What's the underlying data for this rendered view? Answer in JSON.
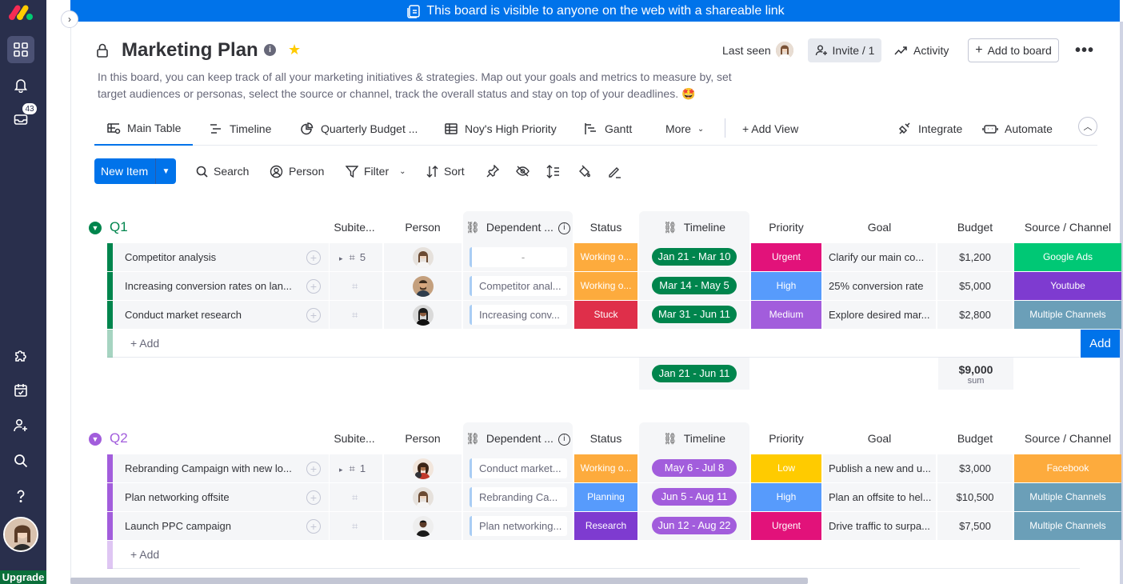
{
  "banner": {
    "text": "This board is visible to anyone on the web with a shareable link"
  },
  "rail": {
    "inbox_count": "43",
    "upgrade_label": "Upgrade"
  },
  "header": {
    "title": "Marketing Plan",
    "description": "In this board, you can keep track of all your marketing initiatives & strategies. Map out your goals and metrics to measure by, set target audiences or personas, select the source or channel, track the overall status and stay on top of your deadlines. 🤩",
    "last_seen_label": "Last seen",
    "invite_label": "Invite / 1",
    "activity_label": "Activity",
    "add_to_board_label": "Add to board",
    "more_label": "•••"
  },
  "tabs": [
    {
      "label": "Main Table",
      "icon": "table-icon"
    },
    {
      "label": "Timeline",
      "icon": "timeline-icon"
    },
    {
      "label": "Quarterly Budget ...",
      "icon": "pie-icon"
    },
    {
      "label": "Noy's High Priority",
      "icon": "grid-icon"
    },
    {
      "label": "Gantt",
      "icon": "gantt-icon"
    },
    {
      "label": "More",
      "icon": "chevron-down-icon"
    },
    {
      "label": "+ Add View",
      "icon": ""
    },
    {
      "label": "Integrate",
      "icon": "integrate-icon"
    },
    {
      "label": "Automate",
      "icon": "robot-icon"
    }
  ],
  "toolbar": {
    "new_item": "New Item",
    "search": "Search",
    "person": "Person",
    "filter": "Filter",
    "sort": "Sort"
  },
  "columns": [
    "Subite...",
    "Person",
    "Dependent ...",
    "Status",
    "Timeline",
    "Priority",
    "Goal",
    "Budget",
    "Source / Channel"
  ],
  "groups": [
    {
      "name": "Q1",
      "color": "#00854d",
      "rows": [
        {
          "name": "Competitor analysis",
          "subitems": "5",
          "dependent": "-",
          "status": "Working o...",
          "status_color": "#fdab3d",
          "timeline": "Jan 21 - Mar 10",
          "priority": "Urgent",
          "priority_color": "#e2127a",
          "goal": "Clarify our main co...",
          "budget": "$1,200",
          "source": "Google Ads",
          "source_color": "#00c875"
        },
        {
          "name": "Increasing conversion rates on lan...",
          "subitems": "",
          "dependent": "Competitor anal...",
          "status": "Working o...",
          "status_color": "#fdab3d",
          "timeline": "Mar 14 - May 5",
          "priority": "High",
          "priority_color": "#579bfc",
          "goal": "25% conversion rate",
          "budget": "$5,000",
          "source": "Youtube",
          "source_color": "#7e3bd0"
        },
        {
          "name": "Conduct market research",
          "subitems": "",
          "dependent": "Increasing conv...",
          "status": "Stuck",
          "status_color": "#df2f4a",
          "timeline": "Mar 31 - Jun 11",
          "priority": "Medium",
          "priority_color": "#a25ddc",
          "goal": "Explore desired mar...",
          "budget": "$2,800",
          "source": "Multiple Channels",
          "source_color": "#6b9fb8"
        }
      ],
      "add_label": "+ Add",
      "add_button": "Add",
      "summary_timeline": "Jan 21 - Jun 11",
      "summary_budget": "$9,000",
      "summary_budget_label": "sum"
    },
    {
      "name": "Q2",
      "color": "#a25ddc",
      "rows": [
        {
          "name": "Rebranding Campaign with new lo...",
          "subitems": "1",
          "dependent": "Conduct market...",
          "status": "Working o...",
          "status_color": "#fdab3d",
          "timeline": "May 6 - Jul 8",
          "priority": "Low",
          "priority_color": "#ffcb00",
          "goal": "Publish a new and u...",
          "budget": "$3,000",
          "source": "Facebook",
          "source_color": "#fdab3d"
        },
        {
          "name": "Plan networking offsite",
          "subitems": "",
          "dependent": "Rebranding Ca...",
          "status": "Planning",
          "status_color": "#579bfc",
          "timeline": "Jun 5 - Aug 11",
          "priority": "High",
          "priority_color": "#579bfc",
          "goal": "Plan an offsite to hel...",
          "budget": "$10,500",
          "source": "Multiple Channels",
          "source_color": "#6b9fb8"
        },
        {
          "name": "Launch PPC campaign",
          "subitems": "",
          "dependent": "Plan networking...",
          "status": "Research",
          "status_color": "#7e3bd0",
          "timeline": "Jun 12 - Aug 22",
          "priority": "Urgent",
          "priority_color": "#e2127a",
          "goal": "Drive traffic to surpa...",
          "budget": "$7,500",
          "source": "Multiple Channels",
          "source_color": "#6b9fb8"
        }
      ],
      "add_label": "+ Add"
    }
  ]
}
